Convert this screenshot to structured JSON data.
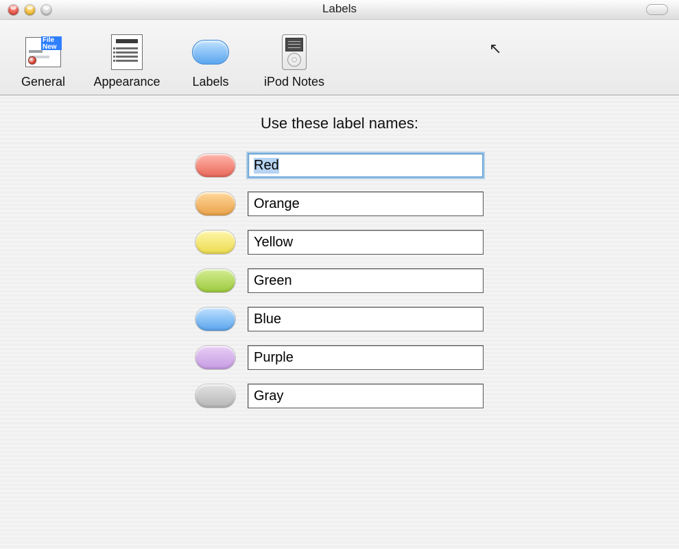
{
  "window": {
    "title": "Labels"
  },
  "toolbar": {
    "items": [
      {
        "id": "general",
        "label": "General"
      },
      {
        "id": "appearance",
        "label": "Appearance"
      },
      {
        "id": "labels",
        "label": "Labels"
      },
      {
        "id": "ipod-notes",
        "label": "iPod Notes"
      }
    ],
    "selected": "labels"
  },
  "content": {
    "heading": "Use these label names:"
  },
  "labels": [
    {
      "color_id": "red",
      "name": "Red",
      "color": "#e9685a",
      "focused": true
    },
    {
      "color_id": "orange",
      "name": "Orange",
      "color": "#eaa24a",
      "focused": false
    },
    {
      "color_id": "yellow",
      "name": "Yellow",
      "color": "#ecdc4f",
      "focused": false
    },
    {
      "color_id": "green",
      "name": "Green",
      "color": "#9ecb3e",
      "focused": false
    },
    {
      "color_id": "blue",
      "name": "Blue",
      "color": "#5aa5ee",
      "focused": false
    },
    {
      "color_id": "purple",
      "name": "Purple",
      "color": "#c79ce3",
      "focused": false
    },
    {
      "color_id": "gray",
      "name": "Gray",
      "color": "#b7b7b7",
      "focused": false
    }
  ]
}
